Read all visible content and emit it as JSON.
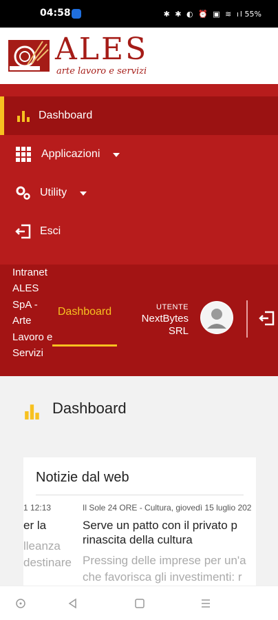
{
  "status_bar": {
    "time": "04:58",
    "icons_text": "✱ ✱ ◐ ⏰ ▣ ≋ ıl",
    "battery": "55%"
  },
  "brand": {
    "title": "ALES",
    "subtitle": "arte lavoro e servizi",
    "color": "#a51c17"
  },
  "nav": {
    "items": [
      {
        "label": "Dashboard",
        "icon": "bar-chart-icon",
        "active": true
      },
      {
        "label": "Applicazioni",
        "icon": "grid-icon",
        "has_caret": true
      },
      {
        "label": "Utility",
        "icon": "gears-icon",
        "has_caret": true
      },
      {
        "label": "Esci",
        "icon": "logout-icon"
      }
    ]
  },
  "topbar": {
    "site_title": "Intranet ALES SpA - Arte Lavoro e Servizi",
    "active_tab": "Dashboard",
    "user_caption": "UTENTE",
    "user_name": "NextBytes SRL"
  },
  "page": {
    "title": "Dashboard",
    "card": {
      "title": "Notizie dal web",
      "news": [
        {
          "meta": "1 12:13",
          "headline": "er la",
          "summary": "lleanza destinare"
        },
        {
          "meta": "Il Sole 24 ORE - Cultura,  giovedì 15 luglio 202",
          "headline": "Serve un patto con il privato p rinascita della cultura",
          "summary": "Pressing delle imprese per un'a che favorisca gli investimenti: r"
        }
      ]
    }
  },
  "colors": {
    "nav_bg": "#b71c1c",
    "active_bg": "#9b1212",
    "accent": "#f7c120",
    "topbar_bg": "#a31414"
  }
}
